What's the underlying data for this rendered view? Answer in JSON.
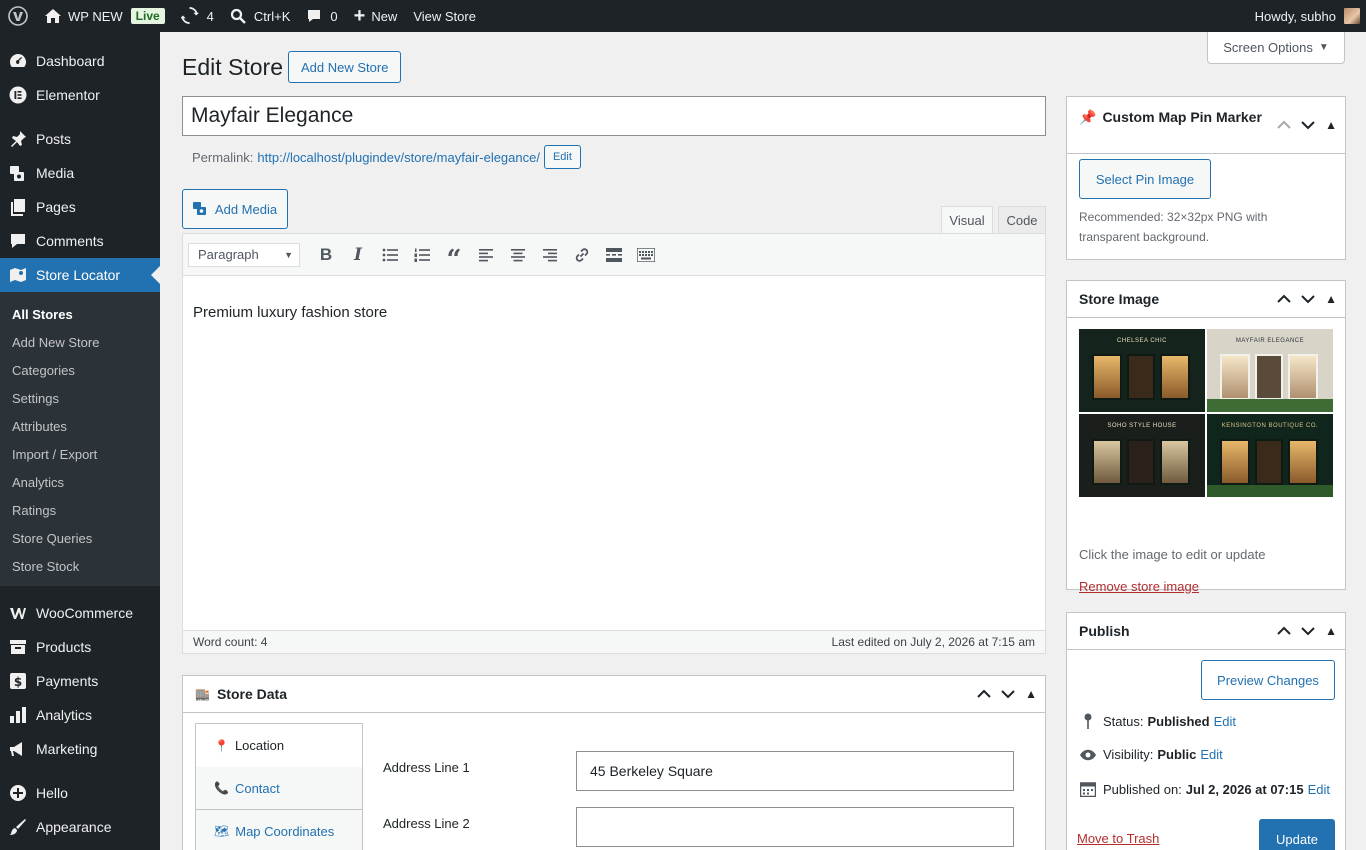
{
  "adminbar": {
    "site_name": "WP NEW",
    "live_badge": "Live",
    "updates_count": "4",
    "search_shortcut": "Ctrl+K",
    "comments_count": "0",
    "new_label": "New",
    "view_store": "View Store",
    "howdy": "Howdy, subho"
  },
  "sidebar": {
    "items": [
      {
        "label": "Dashboard",
        "icon": "dashboard-icon"
      },
      {
        "label": "Elementor",
        "icon": "elementor-icon"
      },
      {
        "label": "Posts",
        "icon": "pin-icon"
      },
      {
        "label": "Media",
        "icon": "media-icon"
      },
      {
        "label": "Pages",
        "icon": "pages-icon"
      },
      {
        "label": "Comments",
        "icon": "comment-icon"
      },
      {
        "label": "Store Locator",
        "icon": "map-icon"
      },
      {
        "label": "WooCommerce",
        "icon": "woo-icon"
      },
      {
        "label": "Products",
        "icon": "archive-icon"
      },
      {
        "label": "Payments",
        "icon": "dollar-icon"
      },
      {
        "label": "Analytics",
        "icon": "bar-chart-icon"
      },
      {
        "label": "Marketing",
        "icon": "megaphone-icon"
      },
      {
        "label": "Hello",
        "icon": "plus-circle-icon"
      },
      {
        "label": "Appearance",
        "icon": "brush-icon"
      }
    ],
    "submenu": [
      "All Stores",
      "Add New Store",
      "Categories",
      "Settings",
      "Attributes",
      "Import / Export",
      "Analytics",
      "Ratings",
      "Store Queries",
      "Store Stock"
    ]
  },
  "main": {
    "screen_options": "Screen Options",
    "page_title": "Edit Store",
    "add_new_button": "Add New Store",
    "post_title": "Mayfair Elegance",
    "permalink_label": "Permalink:",
    "permalink_url": "http://localhost/plugindev/store/mayfair-elegance/",
    "permalink_edit": "Edit",
    "add_media": "Add Media",
    "tab_visual": "Visual",
    "tab_code": "Code",
    "format_select": "Paragraph",
    "content": "Premium luxury fashion store",
    "word_count": "Word count: 4",
    "last_edited": "Last edited on July 2, 2026 at 7:15 am"
  },
  "store_data": {
    "title": "Store Data",
    "tabs": [
      {
        "label": "Location",
        "icon": "location-pin-icon"
      },
      {
        "label": "Contact",
        "icon": "phone-icon"
      },
      {
        "label": "Map Coordinates",
        "icon": "map-icon"
      }
    ],
    "fields": [
      {
        "label": "Address Line 1",
        "value": "45 Berkeley Square"
      },
      {
        "label": "Address Line 2",
        "value": ""
      }
    ]
  },
  "pin_marker": {
    "title": "Custom Map Pin Marker",
    "button": "Select Pin Image",
    "help": "Recommended: 32×32px PNG with transparent background."
  },
  "store_image": {
    "title": "Store Image",
    "shop_signs": [
      "CHELSEA CHIC",
      "MAYFAIR ELEGANCE",
      "SOHO STYLE HOUSE",
      "KENSINGTON BOUTIQUE CO."
    ],
    "hint": "Click the image to edit or update",
    "remove": "Remove store image"
  },
  "publish": {
    "title": "Publish",
    "preview": "Preview Changes",
    "status_label": "Status:",
    "status_value": "Published",
    "visibility_label": "Visibility:",
    "visibility_value": "Public",
    "published_label": "Published on:",
    "published_value": "Jul 2, 2026 at 07:15",
    "edit": "Edit",
    "trash": "Move to Trash",
    "update": "Update"
  },
  "colors": {
    "accent": "#2271b1",
    "admin_dark": "#1d2327",
    "danger": "#b32d2e"
  }
}
